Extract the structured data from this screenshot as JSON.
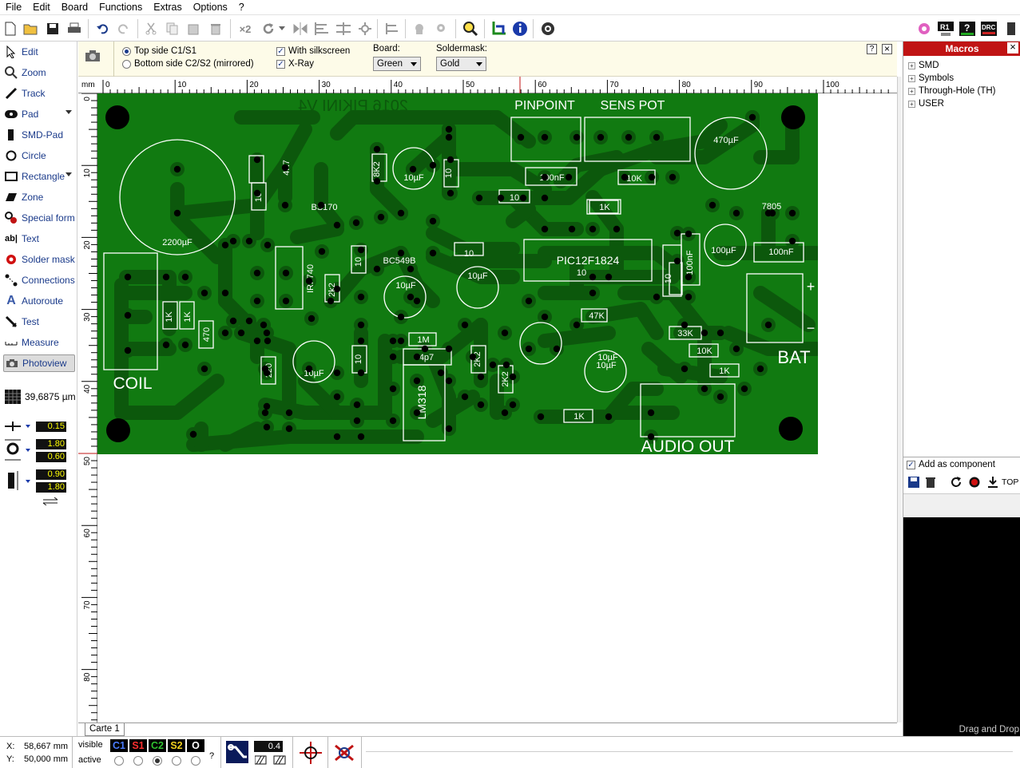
{
  "menu": [
    "File",
    "Edit",
    "Board",
    "Functions",
    "Extras",
    "Options",
    "?"
  ],
  "toolbar": {
    "icons": [
      "new-icon",
      "open-icon",
      "save-icon",
      "print-icon",
      "undo-icon",
      "redo-icon",
      "cut-icon",
      "copy-icon",
      "paste-icon",
      "delete-icon",
      "duplicate-icon",
      "rotate-icon",
      "mirror-icon",
      "align-icon",
      "distribute-icon",
      "flip-icon",
      "group-icon",
      "lock-icon",
      "unlock-icon",
      "zoom-icon",
      "crosshair-icon",
      "info-icon",
      "settings-icon",
      "ring-icon",
      "r1-icon",
      "help-check-icon",
      "drc-icon",
      "power-icon"
    ],
    "duplicate_label": "×2"
  },
  "tools": [
    {
      "label": "Edit",
      "icon": "cursor-icon"
    },
    {
      "label": "Zoom",
      "icon": "zoom-icon"
    },
    {
      "label": "Track",
      "icon": "track-icon"
    },
    {
      "label": "Pad",
      "icon": "pad-icon"
    },
    {
      "label": "SMD-Pad",
      "icon": "smd-pad-icon"
    },
    {
      "label": "Circle",
      "icon": "circle-icon"
    },
    {
      "label": "Rectangle",
      "icon": "rectangle-icon"
    },
    {
      "label": "Zone",
      "icon": "zone-icon"
    },
    {
      "label": "Special form",
      "icon": "special-form-icon"
    },
    {
      "label": "Text",
      "icon": "text-icon"
    },
    {
      "label": "Solder mask",
      "icon": "solder-mask-icon"
    },
    {
      "label": "Connections",
      "icon": "connections-icon"
    },
    {
      "label": "Autoroute",
      "icon": "autoroute-icon"
    },
    {
      "label": "Test",
      "icon": "test-icon"
    },
    {
      "label": "Measure",
      "icon": "measure-icon"
    },
    {
      "label": "Photoview",
      "icon": "camera-icon"
    }
  ],
  "grid_value": "39,6875 µm",
  "params": {
    "track_width": "0.15",
    "pad_outer": "1.80",
    "pad_inner": "0.60",
    "smd_w": "0.90",
    "smd_h": "1.80"
  },
  "photoview": {
    "top_side": "Top side C1/S1",
    "bottom_side": "Bottom side C2/S2 (mirrored)",
    "with_silkscreen": "With silkscreen",
    "xray": "X-Ray",
    "board_label": "Board:",
    "board_value": "Green",
    "soldermask_label": "Soldermask:",
    "soldermask_value": "Gold",
    "help": "?",
    "close": "×"
  },
  "ruler": {
    "unit": "mm",
    "x_ticks": [
      "0",
      "10",
      "20",
      "30",
      "40",
      "50",
      "60",
      "70",
      "80",
      "90",
      "100"
    ],
    "y_ticks": [
      "0",
      "10",
      "20",
      "30",
      "40",
      "50",
      "60",
      "70",
      "80"
    ]
  },
  "board_texts": {
    "header_mirror": "2016 PIKINI V4",
    "pinpoint": "PINPOINT",
    "sens_pot": "SENS POT",
    "coil": "COIL",
    "bat": "BAT",
    "audio_out": "AUDIO OUT",
    "plus": "+",
    "minus": "−",
    "parts": [
      "2200µF",
      "4K7",
      "10",
      "BS170",
      "8K2",
      "10µF",
      "10",
      "100nF",
      "10K",
      "470µF",
      "10",
      "1K",
      "7805",
      "BC549B",
      "10",
      "PIC12F1824",
      "100nF",
      "100µF",
      "10",
      "100nF",
      "IRF740",
      "2k2",
      "10",
      "10µF",
      "10µF",
      "47K",
      "1K",
      "1K",
      "470",
      "33K",
      "10K",
      "1M",
      "4p7",
      "10µF",
      "1K",
      "220",
      "10µF",
      "10",
      "2K2",
      "2K2",
      "LM318",
      "10µF",
      "1K",
      "10"
    ]
  },
  "tab": "Carte 1",
  "macros": {
    "title": "Macros",
    "close": "×",
    "tree": [
      "SMD",
      "Symbols",
      "Through-Hole (TH)",
      "USER"
    ],
    "add_as_component": "Add as component",
    "top_label": "TOP",
    "drag_drop": "Drag and Drop"
  },
  "status": {
    "x_label": "X:",
    "x_value": "58,667 mm",
    "y_label": "Y:",
    "y_value": "50,000 mm",
    "visible": "visible",
    "active": "active",
    "layers": [
      {
        "name": "C1",
        "color": "#4a7cff"
      },
      {
        "name": "S1",
        "color": "#ff3030"
      },
      {
        "name": "C2",
        "color": "#30c030"
      },
      {
        "name": "S2",
        "color": "#f0d020"
      },
      {
        "name": "O",
        "color": "#ffffff"
      }
    ],
    "help": "?",
    "track_value": "0.4"
  },
  "colors": {
    "board": "#117a11",
    "copper": "#0c580c",
    "silk": "#ffffff",
    "accent": "#c01414"
  }
}
